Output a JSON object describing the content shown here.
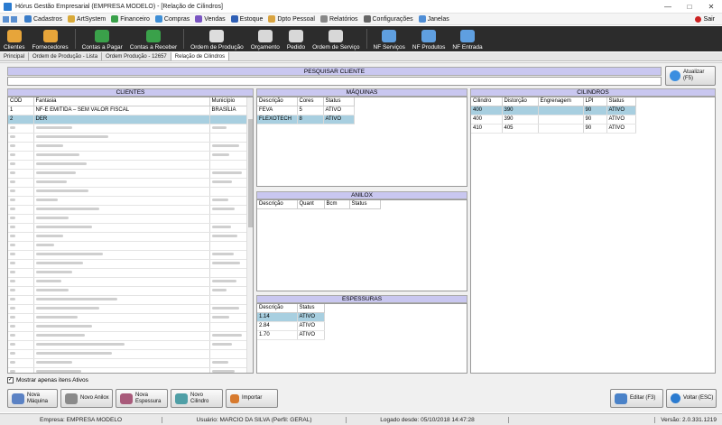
{
  "window": {
    "title": "Hórus Gestão Empresarial (EMPRESA MODELO) - [Relação de Cilindros]"
  },
  "menu": [
    {
      "label": "Cadastros",
      "icon": "people-icon",
      "color": "#3a7dc9"
    },
    {
      "label": "ArtSystem",
      "icon": "art-icon",
      "color": "#d9aa3a"
    },
    {
      "label": "Financeiro",
      "icon": "money-icon",
      "color": "#3aa14a"
    },
    {
      "label": "Compras",
      "icon": "cart-icon",
      "color": "#3f8fd6"
    },
    {
      "label": "Vendas",
      "icon": "sales-icon",
      "color": "#7a55c2"
    },
    {
      "label": "Estoque",
      "icon": "box-icon",
      "color": "#2f5fb5"
    },
    {
      "label": "Dpto Pessoal",
      "icon": "staff-icon",
      "color": "#d9a441"
    },
    {
      "label": "Relatórios",
      "icon": "report-icon",
      "color": "#888888"
    },
    {
      "label": "Configurações",
      "icon": "settings-icon",
      "color": "#666666"
    },
    {
      "label": "Janelas",
      "icon": "windows-icon",
      "color": "#4f8ed6"
    }
  ],
  "sair_label": "Sair",
  "toolbar": [
    {
      "label": "Clientes",
      "icon": "clients-icon",
      "color": "#e7a53a"
    },
    {
      "label": "Fornecedores",
      "icon": "suppliers-icon",
      "color": "#e7a53a"
    },
    {
      "label": "Contas a Pagar",
      "icon": "pay-icon",
      "color": "#3aa14a"
    },
    {
      "label": "Contas a Receber",
      "icon": "receive-icon",
      "color": "#3aa14a"
    },
    {
      "label": "Ordem de Produção",
      "icon": "production-icon",
      "color": "#dddddd"
    },
    {
      "label": "Orçamento",
      "icon": "quote-icon",
      "color": "#d8d8d8"
    },
    {
      "label": "Pedido",
      "icon": "order-icon",
      "color": "#d8d8d8"
    },
    {
      "label": "Ordem de Serviço",
      "icon": "service-icon",
      "color": "#d8d8d8"
    },
    {
      "label": "NF Serviços",
      "icon": "nf-services-icon",
      "color": "#5f9fe0"
    },
    {
      "label": "NF Produtos",
      "icon": "nf-products-icon",
      "color": "#5f9fe0"
    },
    {
      "label": "NF Entrada",
      "icon": "nf-entry-icon",
      "color": "#5f9fe0"
    }
  ],
  "tabs": [
    "Principal",
    "Ordem de Produção - Lista",
    "Ordem Produção - 12657",
    "Relação de Cilindros"
  ],
  "search": {
    "label": "PESQUISAR CLIENTE",
    "value": ""
  },
  "atualizar_label": "Atualizar (F5)",
  "clientes": {
    "header": "CLIENTES",
    "columns": [
      "COD",
      "Fantasia",
      "Município"
    ],
    "rows": [
      {
        "cod": "1",
        "fantasia": "NF-E EMITIDA – SEM VALOR FISCAL",
        "municipio": "BRASÍLIA"
      },
      {
        "cod": "2",
        "fantasia": "DER",
        "municipio": ""
      }
    ]
  },
  "maquinas": {
    "header": "MÁQUINAS",
    "columns": [
      "Descrição",
      "Cores",
      "Status"
    ],
    "rows": [
      {
        "descricao": "FEVA",
        "cores": "5",
        "status": "ATIVO"
      },
      {
        "descricao": "FLEXOTECH",
        "cores": "8",
        "status": "ATIVO"
      }
    ]
  },
  "anilox": {
    "header": "ANILOX",
    "columns": [
      "Descrição",
      "Quant",
      "Bcm",
      "Status"
    ]
  },
  "espessuras": {
    "header": "ESPESSURAS",
    "columns": [
      "Descrição",
      "Status"
    ],
    "rows": [
      {
        "descricao": "1.14",
        "status": "ATIVO"
      },
      {
        "descricao": "2.84",
        "status": "ATIVO"
      },
      {
        "descricao": "1.70",
        "status": "ATIVO"
      }
    ]
  },
  "cilindros": {
    "header": "CILINDROS",
    "columns": [
      "Cilindro",
      "Distorção",
      "Engrenagem",
      "LPI",
      "Status"
    ],
    "rows": [
      {
        "cilindro": "400",
        "distorcao": "390",
        "engrenagem": "",
        "lpi": "90",
        "status": "ATIVO"
      },
      {
        "cilindro": "400",
        "distorcao": "390",
        "engrenagem": "",
        "lpi": "90",
        "status": "ATIVO"
      },
      {
        "cilindro": "410",
        "distorcao": "405",
        "engrenagem": "",
        "lpi": "90",
        "status": "ATIVO"
      }
    ]
  },
  "mostrar_ativos_label": "Mostrar apenas itens Ativos",
  "buttons": {
    "nova_maquina": "Nova Máquina",
    "novo_anilox": "Novo Anilox",
    "nova_espessura": "Nova Espessura",
    "novo_cilindro": "Novo Cilindro",
    "importar": "Importar",
    "editar": "Editar (F3)",
    "voltar": "Voltar (ESC)"
  },
  "status": {
    "empresa": "Empresa: EMPRESA MODELO",
    "usuario": "Usuário: MARCIO DA SILVA (Perfil: GERAL)",
    "logado": "Logado desde: 05/10/2018 14:47:28",
    "versao": "Versão: 2.0.331.1219"
  }
}
